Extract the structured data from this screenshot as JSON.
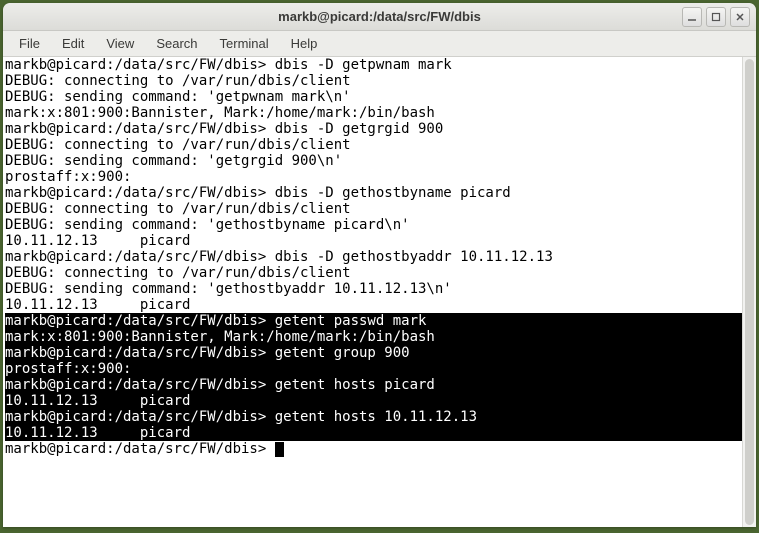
{
  "window": {
    "title": "markb@picard:/data/src/FW/dbis"
  },
  "menu": {
    "items": [
      "File",
      "Edit",
      "View",
      "Search",
      "Terminal",
      "Help"
    ]
  },
  "terminal": {
    "prompt": "markb@picard:/data/src/FW/dbis>",
    "lines": [
      {
        "inv": false,
        "text": "markb@picard:/data/src/FW/dbis> dbis -D getpwnam mark"
      },
      {
        "inv": false,
        "text": "DEBUG: connecting to /var/run/dbis/client"
      },
      {
        "inv": false,
        "text": "DEBUG: sending command: 'getpwnam mark\\n'"
      },
      {
        "inv": false,
        "text": "mark:x:801:900:Bannister, Mark:/home/mark:/bin/bash"
      },
      {
        "inv": false,
        "text": "markb@picard:/data/src/FW/dbis> dbis -D getgrgid 900"
      },
      {
        "inv": false,
        "text": "DEBUG: connecting to /var/run/dbis/client"
      },
      {
        "inv": false,
        "text": "DEBUG: sending command: 'getgrgid 900\\n'"
      },
      {
        "inv": false,
        "text": "prostaff:x:900:"
      },
      {
        "inv": false,
        "text": "markb@picard:/data/src/FW/dbis> dbis -D gethostbyname picard"
      },
      {
        "inv": false,
        "text": "DEBUG: connecting to /var/run/dbis/client"
      },
      {
        "inv": false,
        "text": "DEBUG: sending command: 'gethostbyname picard\\n'"
      },
      {
        "inv": false,
        "text": "10.11.12.13     picard"
      },
      {
        "inv": false,
        "text": "markb@picard:/data/src/FW/dbis> dbis -D gethostbyaddr 10.11.12.13"
      },
      {
        "inv": false,
        "text": "DEBUG: connecting to /var/run/dbis/client"
      },
      {
        "inv": false,
        "text": "DEBUG: sending command: 'gethostbyaddr 10.11.12.13\\n'"
      },
      {
        "inv": false,
        "text": "10.11.12.13     picard"
      },
      {
        "inv": true,
        "text": "markb@picard:/data/src/FW/dbis> getent passwd mark"
      },
      {
        "inv": true,
        "text": "mark:x:801:900:Bannister, Mark:/home/mark:/bin/bash"
      },
      {
        "inv": true,
        "text": "markb@picard:/data/src/FW/dbis> getent group 900"
      },
      {
        "inv": true,
        "text": "prostaff:x:900:"
      },
      {
        "inv": true,
        "text": "markb@picard:/data/src/FW/dbis> getent hosts picard"
      },
      {
        "inv": true,
        "text": "10.11.12.13     picard"
      },
      {
        "inv": true,
        "text": "markb@picard:/data/src/FW/dbis> getent hosts 10.11.12.13"
      },
      {
        "inv": true,
        "text": "10.11.12.13     picard"
      }
    ],
    "current_prompt": "markb@picard:/data/src/FW/dbis> "
  }
}
